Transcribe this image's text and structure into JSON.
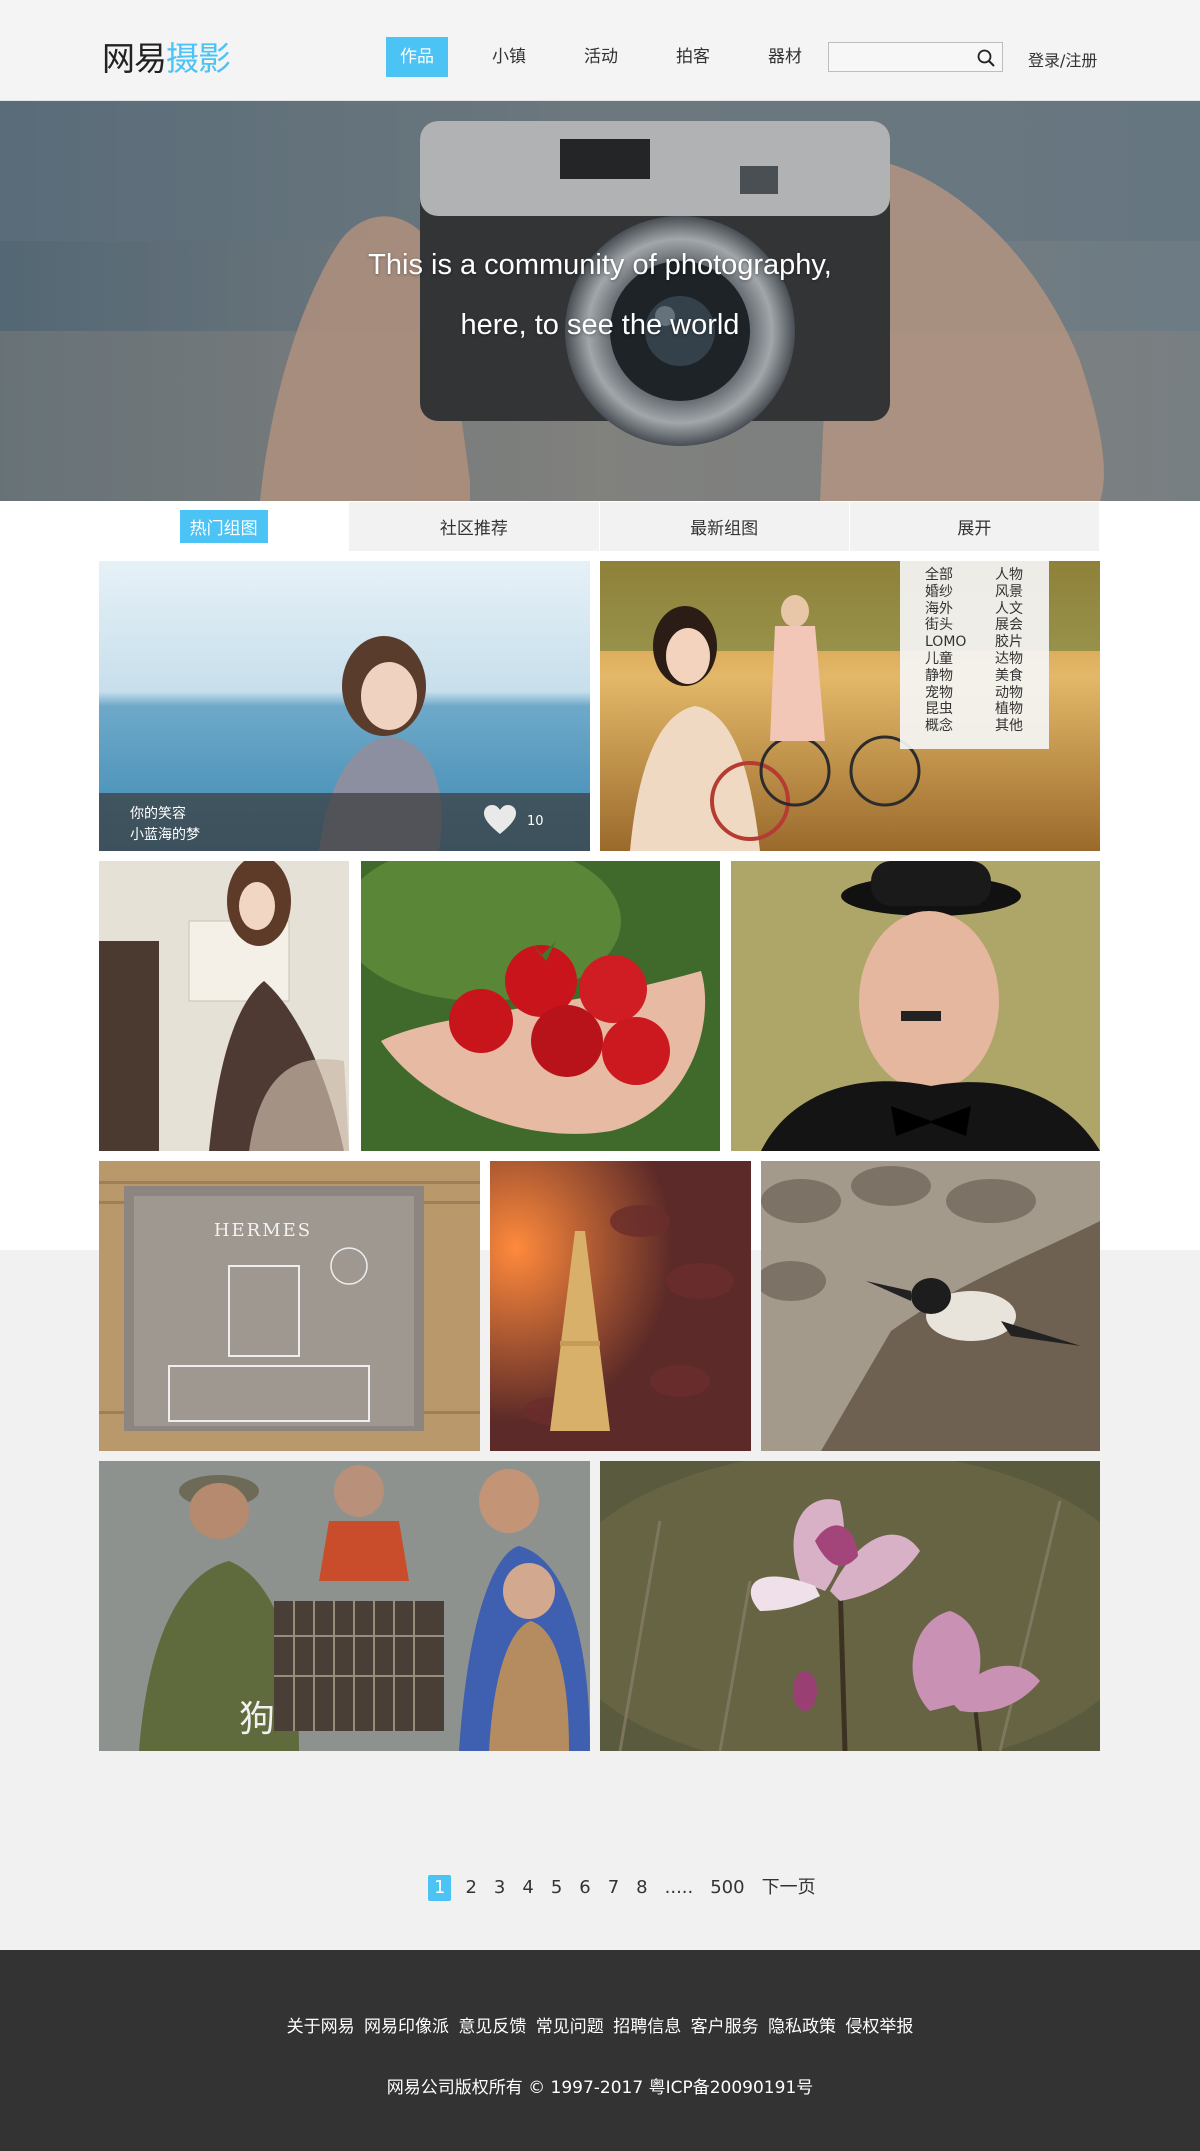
{
  "header": {
    "logo_part1": "网易",
    "logo_part2": "摄影",
    "nav": [
      "作品",
      "小镇",
      "活动",
      "拍客",
      "器材"
    ],
    "search_placeholder": "",
    "login": "登录/注册",
    "accent": "#4cc3f5"
  },
  "hero": {
    "line1": "This is a community of photography,",
    "line2": "here, to see the world"
  },
  "tabs": [
    "热门组图",
    "社区推荐",
    "最新组图",
    "展开"
  ],
  "featured": {
    "caption1": "你的笑容",
    "caption2": "小蓝海的梦",
    "likes": "10"
  },
  "categories": {
    "left": [
      "全部",
      "婚纱",
      "海外",
      "街头",
      "LOMO",
      "儿童",
      "静物",
      "宠物",
      "昆虫",
      "概念"
    ],
    "right": [
      "人物",
      "风景",
      "人文",
      "展会",
      "胶片",
      "达物",
      "美食",
      "动物",
      "植物",
      "其他"
    ]
  },
  "photos": [
    {
      "subject": "girl-by-sea"
    },
    {
      "subject": "couple-with-bicycle"
    },
    {
      "subject": "woman-in-dress"
    },
    {
      "subject": "strawberries-in-hand"
    },
    {
      "subject": "man-in-bowler-hat"
    },
    {
      "subject": "hermes-storefront",
      "text": "HERMES"
    },
    {
      "subject": "eiffel-tower-leaves"
    },
    {
      "subject": "kingfisher-on-rock"
    },
    {
      "subject": "family-with-dog-cage",
      "text": "狗"
    },
    {
      "subject": "magnolia-flowers"
    }
  ],
  "pagination": {
    "pages": [
      "1",
      "2",
      "3",
      "4",
      "5",
      "6",
      "7",
      "8",
      ".....",
      "500"
    ],
    "next": "下一页",
    "current": "1"
  },
  "footer": {
    "links": [
      "关于网易",
      "网易印像派",
      "意见反馈",
      "常见问题",
      "招聘信息",
      "客户服务",
      "隐私政策",
      "侵权举报"
    ],
    "copyright": "网易公司版权所有 © 1997-2017    粤ICP备20090191号"
  }
}
